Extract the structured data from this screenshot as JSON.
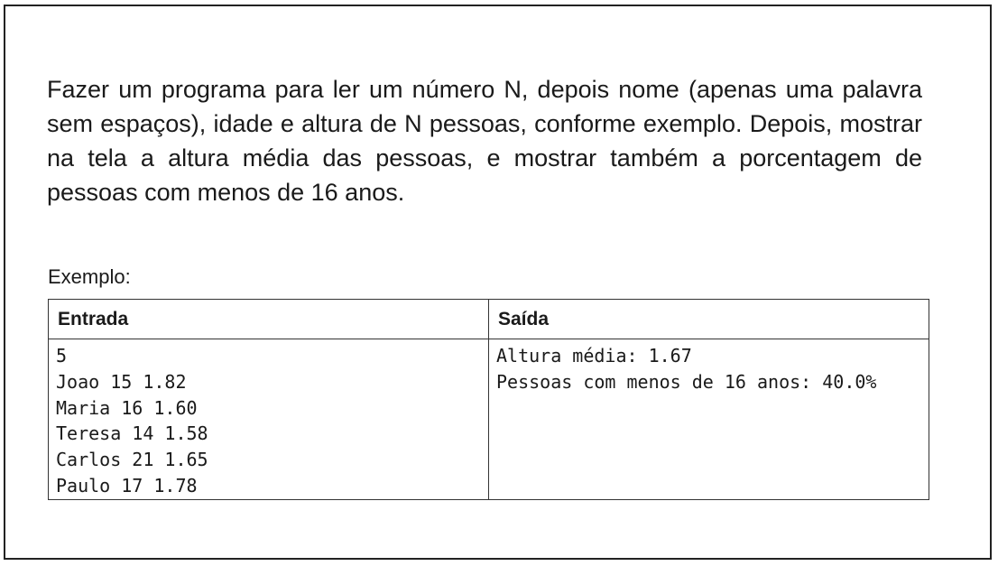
{
  "statement": "Fazer um programa para ler um número N, depois nome (apenas uma palavra sem espaços), idade e altura de N pessoas, conforme exemplo. Depois, mostrar na tela a altura média das pessoas, e mostrar também a porcentagem de pessoas com menos de 16 anos.",
  "example": {
    "label": "Exemplo:",
    "headers": {
      "input": "Entrada",
      "output": "Saída"
    },
    "input_lines": [
      "5",
      "Joao 15 1.82",
      "Maria 16 1.60",
      "Teresa 14 1.58",
      "Carlos 21 1.65",
      "Paulo 17 1.78"
    ],
    "output_lines": [
      "Altura média: 1.67",
      "Pessoas com menos de 16 anos: 40.0%"
    ]
  }
}
